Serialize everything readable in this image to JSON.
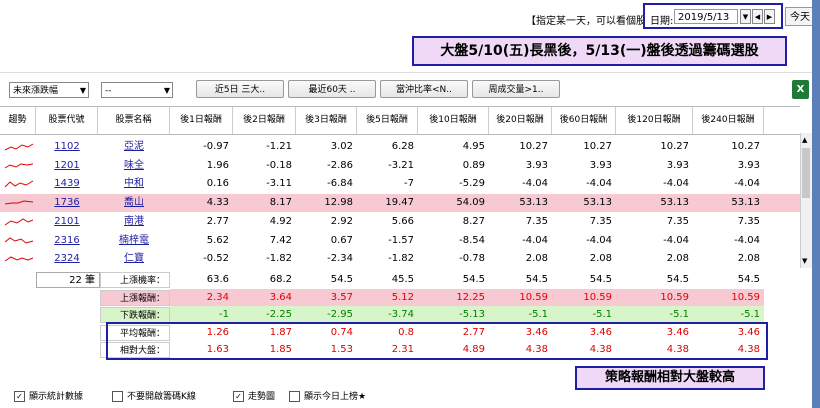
{
  "top": {
    "hint": "【指定某一天，可以看個股後來的報酬】",
    "date_label": "日期:",
    "date_value": "2019/5/13",
    "today_btn": "今天"
  },
  "banner": "大盤5/10(五)長黑後，5/13(一)盤後透過籌碼選股",
  "toolbar": {
    "filter1": "未來漲跌幅",
    "filter2": "--",
    "btn1": "近5日 三大..",
    "btn2": "最近60天 ..",
    "btn3": "當沖比率<N..",
    "btn4": "周成交量>1.."
  },
  "headers": [
    "趨勢",
    "股票代號",
    "股票名稱",
    "後1日報酬",
    "後2日報酬",
    "後3日報酬",
    "後5日報酬",
    "後10日報酬",
    "後20日報酬",
    "後60日報酬",
    "後120日報酬",
    "後240日報酬"
  ],
  "rows": [
    {
      "code": "1102",
      "name": "亞泥",
      "vals": [
        "-0.97",
        "-1.21",
        "3.02",
        "6.28",
        "4.95",
        "10.27",
        "10.27",
        "10.27",
        "10.27"
      ]
    },
    {
      "code": "1201",
      "name": "味全",
      "vals": [
        "1.96",
        "-0.18",
        "-2.86",
        "-3.21",
        "0.89",
        "3.93",
        "3.93",
        "3.93",
        "3.93"
      ]
    },
    {
      "code": "1439",
      "name": "中和",
      "vals": [
        "0.16",
        "-3.11",
        "-6.84",
        "-7",
        "-5.29",
        "-4.04",
        "-4.04",
        "-4.04",
        "-4.04"
      ]
    },
    {
      "code": "1736",
      "name": "喬山",
      "vals": [
        "4.33",
        "8.17",
        "12.98",
        "19.47",
        "54.09",
        "53.13",
        "53.13",
        "53.13",
        "53.13"
      ]
    },
    {
      "code": "2101",
      "name": "南港",
      "vals": [
        "2.77",
        "4.92",
        "2.92",
        "5.66",
        "8.27",
        "7.35",
        "7.35",
        "7.35",
        "7.35"
      ]
    },
    {
      "code": "2316",
      "name": "楠梓電",
      "vals": [
        "5.62",
        "7.42",
        "0.67",
        "-1.57",
        "-8.54",
        "-4.04",
        "-4.04",
        "-4.04",
        "-4.04"
      ]
    },
    {
      "code": "2324",
      "name": "仁寶",
      "vals": [
        "-0.52",
        "-1.82",
        "-2.34",
        "-1.82",
        "-0.78",
        "2.08",
        "2.08",
        "2.08",
        "2.08"
      ]
    }
  ],
  "stats": {
    "count": "22 筆",
    "up_ratio": {
      "label": "上漲機率：",
      "vals": [
        "63.6",
        "68.2",
        "54.5",
        "45.5",
        "54.5",
        "54.5",
        "54.5",
        "54.5",
        "54.5"
      ]
    },
    "up_ret": {
      "label": "上漲報酬：",
      "vals": [
        "2.34",
        "3.64",
        "3.57",
        "5.12",
        "12.25",
        "10.59",
        "10.59",
        "10.59",
        "10.59"
      ]
    },
    "down_ret": {
      "label": "下跌報酬：",
      "vals": [
        "-1",
        "-2.25",
        "-2.95",
        "-3.74",
        "-5.13",
        "-5.1",
        "-5.1",
        "-5.1",
        "-5.1"
      ]
    },
    "avg_ret": {
      "label": "平均報酬：",
      "vals": [
        "1.26",
        "1.87",
        "0.74",
        "0.8",
        "2.77",
        "3.46",
        "3.46",
        "3.46",
        "3.46"
      ]
    },
    "rel_market": {
      "label": "相對大盤：",
      "vals": [
        "1.63",
        "1.85",
        "1.53",
        "2.31",
        "4.89",
        "4.38",
        "4.38",
        "4.38",
        "4.38"
      ]
    }
  },
  "callout": "策略報酬相對大盤較高",
  "footer": {
    "c1": "顯示統計數據",
    "c2": "不要開啟籌碼K線",
    "c3": "走勢圖",
    "c4": "顯示今日上榜★"
  },
  "colors": {
    "highlight": "#f7c9d2",
    "up": "#e00000",
    "down": "#008000",
    "border": "#1f1fa3",
    "banner_bg": "#efd9f6"
  }
}
